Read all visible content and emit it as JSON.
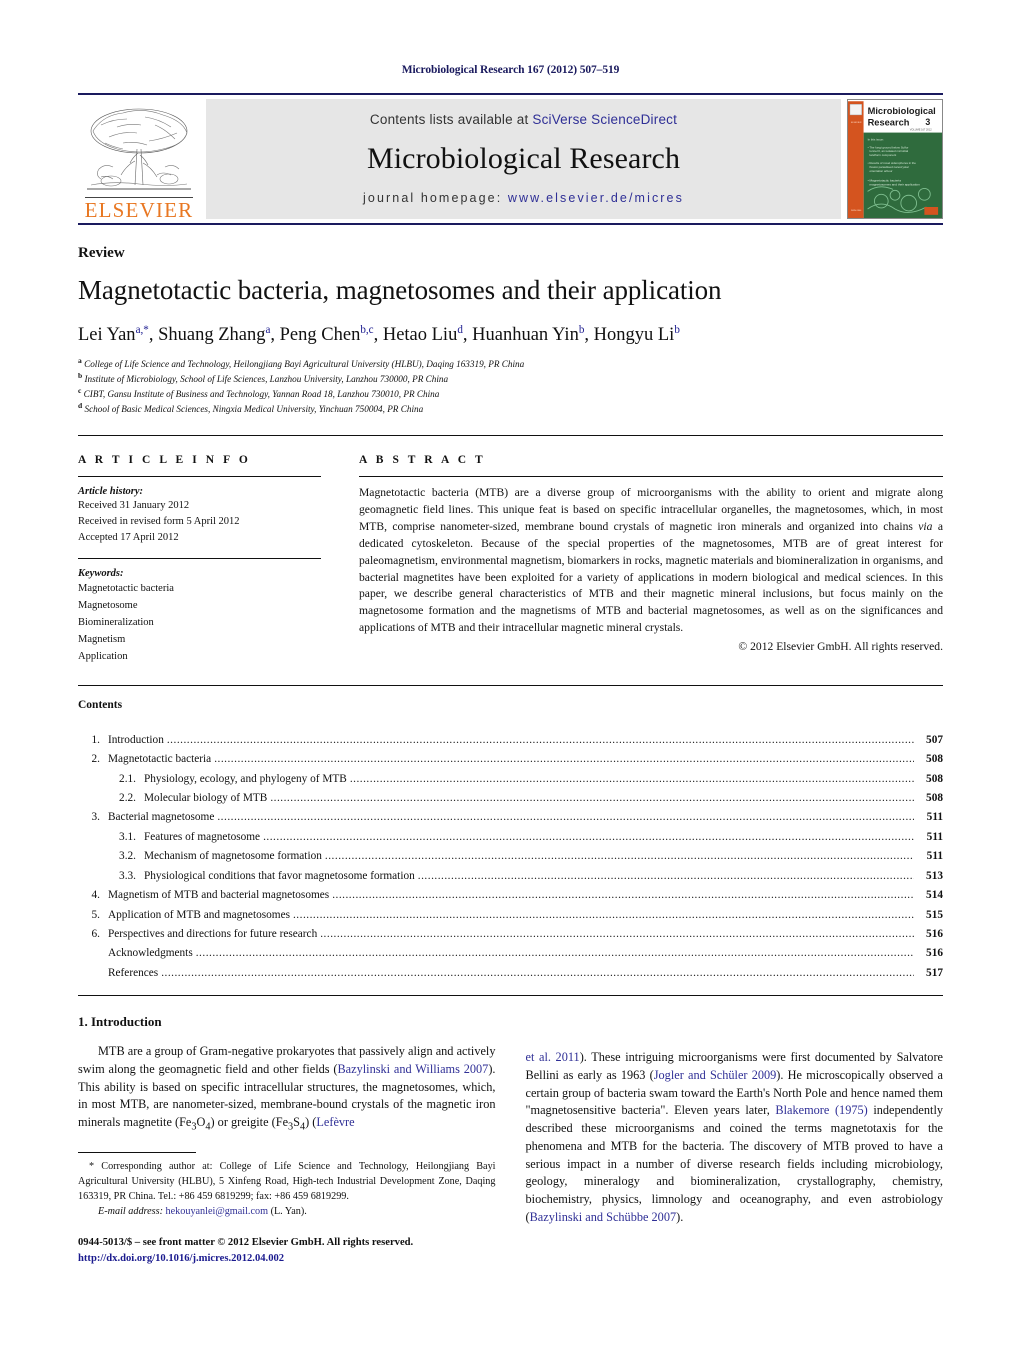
{
  "running_head": "Microbiological Research 167 (2012) 507–519",
  "masthead": {
    "contents_prefix": "Contents lists available at ",
    "sciencedirect_link": "SciVerse ScienceDirect",
    "journal_name": "Microbiological Research",
    "homepage_prefix": "journal homepage: ",
    "homepage_url": "www.elsevier.de/micres",
    "publisher_name": "ELSEVIER",
    "cover_title_line1": "Microbiological",
    "cover_title_line2": "Research",
    "cover_volume": "3"
  },
  "article": {
    "doctype": "Review",
    "title": "Magnetotactic bacteria, magnetosomes and their application",
    "authors": [
      {
        "name": "Lei Yan",
        "sup": "a,*"
      },
      {
        "name": "Shuang Zhang",
        "sup": "a"
      },
      {
        "name": "Peng Chen",
        "sup": "b,c"
      },
      {
        "name": "Hetao Liu",
        "sup": "d"
      },
      {
        "name": "Huanhuan Yin",
        "sup": "b"
      },
      {
        "name": "Hongyu Li",
        "sup": "b"
      }
    ],
    "affiliations": [
      {
        "mark": "a",
        "text": "College of Life Science and Technology, Heilongjiang Bayi Agricultural University (HLBU), Daqing 163319, PR China"
      },
      {
        "mark": "b",
        "text": "Institute of Microbiology, School of Life Sciences, Lanzhou University, Lanzhou 730000, PR China"
      },
      {
        "mark": "c",
        "text": "CIBT, Gansu Institute of Business and Technology, Yannan Road 18, Lanzhou 730010, PR China"
      },
      {
        "mark": "d",
        "text": "School of Basic Medical Sciences, Ningxia Medical University, Yinchuan 750004, PR China"
      }
    ]
  },
  "article_info": {
    "heading": "A R T I C L E   I N F O",
    "history_label": "Article history:",
    "history": [
      "Received 31 January 2012",
      "Received in revised form 5 April 2012",
      "Accepted 17 April 2012"
    ],
    "keywords_label": "Keywords:",
    "keywords": [
      "Magnetotactic bacteria",
      "Magnetosome",
      "Biomineralization",
      "Magnetism",
      "Application"
    ]
  },
  "abstract": {
    "heading": "A B S T R A C T",
    "text_part1": "Magnetotactic bacteria (MTB) are a diverse group of microorganisms with the ability to orient and migrate along geomagnetic field lines. This unique feat is based on specific intracellular organelles, the magnetosomes, which, in most MTB, comprise nanometer-sized, membrane bound crystals of magnetic iron minerals and organized into chains ",
    "italic_word": "via",
    "text_part2": " a dedicated cytoskeleton. Because of the special properties of the magnetosomes, MTB are of great interest for paleomagnetism, environmental magnetism, biomarkers in rocks, magnetic materials and biomineralization in organisms, and bacterial magnetites have been exploited for a variety of applications in modern biological and medical sciences. In this paper, we describe general characteristics of MTB and their magnetic mineral inclusions, but focus mainly on the magnetosome formation and the magnetisms of MTB and bacterial magnetosomes, as well as on the significances and applications of MTB and their intracellular magnetic mineral crystals.",
    "copyright": "© 2012 Elsevier GmbH. All rights reserved."
  },
  "contents": {
    "title": "Contents",
    "entries": [
      {
        "num": "1.",
        "label": "Introduction",
        "page": "507",
        "level": 1
      },
      {
        "num": "2.",
        "label": "Magnetotactic bacteria",
        "page": "508",
        "level": 1
      },
      {
        "num": "2.1.",
        "label": "Physiology, ecology, and phylogeny of MTB",
        "page": "508",
        "level": 2
      },
      {
        "num": "2.2.",
        "label": "Molecular biology of MTB",
        "page": "508",
        "level": 2
      },
      {
        "num": "3.",
        "label": "Bacterial magnetosome",
        "page": "511",
        "level": 1
      },
      {
        "num": "3.1.",
        "label": "Features of magnetosome",
        "page": "511",
        "level": 2
      },
      {
        "num": "3.2.",
        "label": "Mechanism of magnetosome formation",
        "page": "511",
        "level": 2
      },
      {
        "num": "3.3.",
        "label": "Physiological conditions that favor magnetosome formation",
        "page": "513",
        "level": 2
      },
      {
        "num": "4.",
        "label": "Magnetism of MTB and bacterial magnetosomes",
        "page": "514",
        "level": 1
      },
      {
        "num": "5.",
        "label": "Application of MTB and magnetosomes",
        "page": "515",
        "level": 1
      },
      {
        "num": "6.",
        "label": "Perspectives and directions for future research",
        "page": "516",
        "level": 1
      },
      {
        "num": "",
        "label": "Acknowledgments",
        "page": "516",
        "level": 1
      },
      {
        "num": "",
        "label": "References",
        "page": "517",
        "level": 1
      }
    ]
  },
  "introduction": {
    "heading": "1.  Introduction",
    "left_para_a": "MTB are a group of Gram-negative prokaryotes that passively align and actively swim along the geomagnetic field and other fields (",
    "left_ref_1": "Bazylinski and Williams 2007",
    "left_para_b": "). This ability is based on specific intracellular structures, the magnetosomes, which, in most MTB, are nanometer-sized, membrane-bound crystals of the magnetic iron minerals magnetite (Fe",
    "left_sub_1": "3",
    "left_para_c": "O",
    "left_sub_2": "4",
    "left_para_d": ") or greigite (Fe",
    "left_sub_3": "3",
    "left_para_e": "S",
    "left_sub_4": "4",
    "left_para_f": ") (",
    "left_ref_2": "Lefèvre",
    "right_ref_2_cont": "et al. 2011",
    "right_para_a": "). These intriguing microorganisms were first documented by Salvatore Bellini as early as 1963 (",
    "right_ref_1": "Jogler and Schüler 2009",
    "right_para_b": "). He microscopically observed a certain group of bacteria swam toward the Earth's North Pole and hence named them \"magnetosensitive bacteria\". Eleven years later, ",
    "right_ref_3": "Blakemore (1975)",
    "right_para_c": " independently described these microorganisms and coined the terms magnetotaxis for the phenomena and MTB for the bacteria. The discovery of MTB proved to have a serious impact in a number of diverse research fields including microbiology, geology, mineralogy and biomineralization, crystallography, chemistry, biochemistry, physics, limnology and oceanography, and even astrobiology (",
    "right_ref_4": "Bazylinski and Schübbe 2007",
    "right_para_d": ")."
  },
  "footnote": {
    "star": "*",
    "corresponding": " Corresponding author at: College of Life Science and Technology, Heilongjiang Bayi Agricultural University (HLBU), 5 Xinfeng Road, High-tech Industrial Development Zone, Daqing 163319, PR China. Tel.: +86 459 6819299; fax: +86 459 6819299.",
    "email_label": "E-mail address:",
    "email": "hekouyanlei@gmail.com",
    "email_suffix": " (L. Yan).",
    "imprint": "0944-5013/$ – see front matter © 2012 Elsevier GmbH. All rights reserved.",
    "doi": "http://dx.doi.org/10.1016/j.micres.2012.04.002"
  },
  "colors": {
    "link": "#2f2f96",
    "heading_navy": "#1a1a5e",
    "elsevier_orange": "#E87722",
    "band_gray": "#e6e6e6"
  }
}
